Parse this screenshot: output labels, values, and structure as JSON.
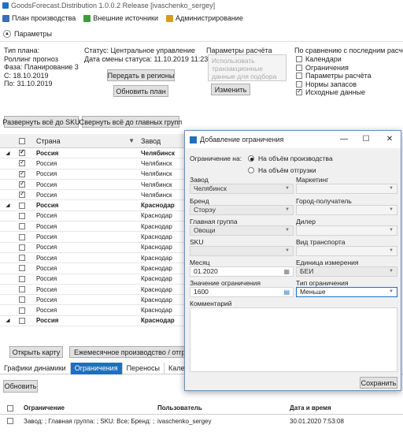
{
  "window": {
    "title": "GoodsForecast.Distribution 1.0.0.2 Release [ivaschenko_sergey]"
  },
  "menu": [
    {
      "label": "План производства",
      "icon": "plan-icon",
      "color": "#3b6fb6"
    },
    {
      "label": "Внешние источники",
      "icon": "sources-icon",
      "color": "#3d9c3d"
    },
    {
      "label": "Администрирование",
      "icon": "admin-icon",
      "color": "#d89a2a"
    }
  ],
  "params_toggle": {
    "label": "Параметры"
  },
  "plan_info": {
    "type_label": "Тип плана:",
    "type_value": "Роллинг прогноз",
    "phase": "Фаза: Планирование 3",
    "from": "С: 18.10.2019",
    "to": "По: 31.10.2019"
  },
  "status": {
    "status": "Статус: Центральное управление",
    "changed": "Дата смены статуса: 11.10.2019 11:23",
    "send_button": "Передать в регионы",
    "refresh_button": "Обновить план"
  },
  "calc": {
    "title": "Параметры расчёта",
    "use_lines": [
      "Использовать",
      "транзакционные",
      "данные   для   подбора"
    ],
    "change_button": "Изменить"
  },
  "compare": {
    "title": "По сравнению с последним расчётом",
    "items": [
      {
        "label": "Календари",
        "checked": false
      },
      {
        "label": "Ограничения",
        "checked": false
      },
      {
        "label": "Параметры расчёта",
        "checked": false
      },
      {
        "label": "Нормы запасов",
        "checked": false
      },
      {
        "label": "Исходные данные",
        "checked": true
      }
    ]
  },
  "toolbar": {
    "expand_all": "Развернуть всё до SKU",
    "collapse_all": "Свернуть всё до главных групп"
  },
  "grid": {
    "columns": [
      "Страна",
      "Завод"
    ],
    "rows": [
      {
        "country": "Россия",
        "plant": "Челябинск",
        "group": true,
        "checked": true
      },
      {
        "country": "Россия",
        "plant": "Челябинск",
        "group": false,
        "checked": true
      },
      {
        "country": "Россия",
        "plant": "Челябинск",
        "group": false,
        "checked": true
      },
      {
        "country": "Россия",
        "plant": "Челябинск",
        "group": false,
        "checked": true
      },
      {
        "country": "Россия",
        "plant": "Челябинск",
        "group": false,
        "checked": true
      },
      {
        "country": "Россия",
        "plant": "Краснодар",
        "group": true,
        "checked": false
      },
      {
        "country": "Россия",
        "plant": "Краснодар",
        "group": false,
        "checked": false
      },
      {
        "country": "Россия",
        "plant": "Краснодар",
        "group": false,
        "checked": false
      },
      {
        "country": "Россия",
        "plant": "Краснодар",
        "group": false,
        "checked": false
      },
      {
        "country": "Россия",
        "plant": "Краснодар",
        "group": false,
        "checked": false
      },
      {
        "country": "Россия",
        "plant": "Краснодар",
        "group": false,
        "checked": false
      },
      {
        "country": "Россия",
        "plant": "Краснодар",
        "group": false,
        "checked": false
      },
      {
        "country": "Россия",
        "plant": "Краснодар",
        "group": false,
        "checked": false
      },
      {
        "country": "Россия",
        "plant": "Краснодар",
        "group": false,
        "checked": false
      },
      {
        "country": "Россия",
        "plant": "Краснодар",
        "group": false,
        "checked": false
      },
      {
        "country": "Россия",
        "plant": "Краснодар",
        "group": false,
        "checked": false
      },
      {
        "country": "Россия",
        "plant": "Краснодар",
        "group": true,
        "checked": false
      }
    ]
  },
  "bottom_buttons": {
    "open_map": "Открыть карту",
    "monthly": "Ежемесячное производство / отгруз"
  },
  "tabs": [
    {
      "label": "Графики динамики",
      "active": false
    },
    {
      "label": "Ограничения",
      "active": true
    },
    {
      "label": "Переносы",
      "active": false
    },
    {
      "label": "Кален",
      "active": false
    }
  ],
  "refresh": "Обновить",
  "log": {
    "columns": [
      "Ограничение",
      "Пользователь",
      "Дата и время"
    ],
    "rows": [
      {
        "constraint": "Завод: ; Главная группа: ; SKU: Все; Бренд: ;",
        "user": "ivaschenko_sergey",
        "datetime": "30.01.2020 7:53:08"
      }
    ]
  },
  "dialog": {
    "title": "Добавление ограничения",
    "constraint_on_label": "Ограничение на:",
    "radio_production": "На объём производства",
    "radio_shipment": "На объём отгрузки",
    "plant_label": "Завод",
    "plant_value": "Челябинск",
    "marketing_label": "Маркетинг",
    "brand_label": "Бренд",
    "brand_value": "Сторэу",
    "city_label": "Город-получатель",
    "main_group_label": "Главная группа",
    "main_group_value": "Овощи",
    "dealer_label": "Дилер",
    "sku_label": "SKU",
    "transport_label": "Вид транспорта",
    "month_label": "Месяц",
    "month_value": "01.2020",
    "unit_label": "Единица измерения",
    "unit_value": "БЕИ",
    "value_label": "Значение ограничения",
    "value_value": "1600",
    "type_label": "Тип ограничения",
    "type_value": "Меньше",
    "comment_label": "Комментарий",
    "save_button": "Сохранить"
  }
}
